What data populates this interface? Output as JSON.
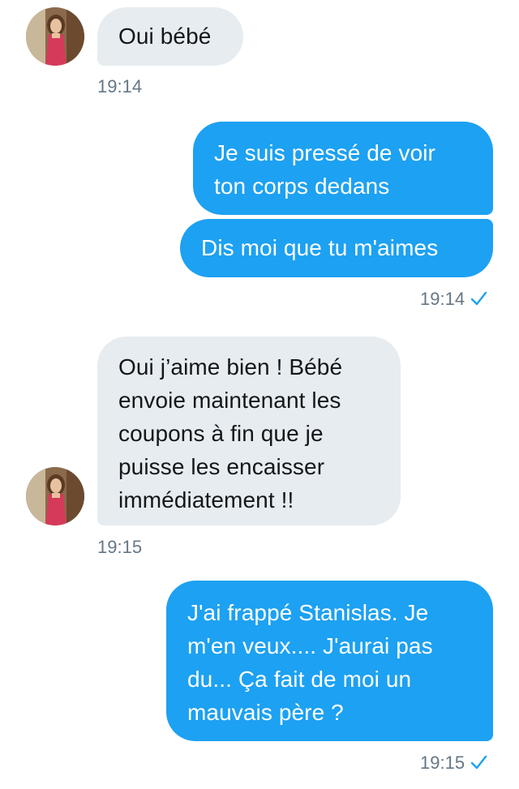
{
  "colors": {
    "incoming_bubble": "#e6ecf0",
    "outgoing_bubble": "#1da1f2",
    "timestamp": "#657786",
    "read_check": "#1da1f2"
  },
  "messages": [
    {
      "from": "contact",
      "text": "Oui bébé"
    },
    {
      "from": "me",
      "text": "Je suis pressé de voir\nton corps dedans"
    },
    {
      "from": "me",
      "text": "Dis moi que tu m'aimes"
    },
    {
      "from": "contact",
      "text": "Oui j’aime bien ! Bébé\nenvoie maintenant les\ncoupons à fin que je\npuisse les encaisser\nimmédiatement !!"
    },
    {
      "from": "me",
      "text": "J'ai frappé Stanislas. Je\nm'en veux.... J'aurai pas\ndu... Ça fait de moi un\nmauvais père ?"
    }
  ],
  "timestamps": [
    "19:14",
    "19:14",
    "19:15",
    "19:15"
  ],
  "icons": {
    "avatar": "contact-avatar",
    "read_receipt": "checkmark-icon"
  }
}
